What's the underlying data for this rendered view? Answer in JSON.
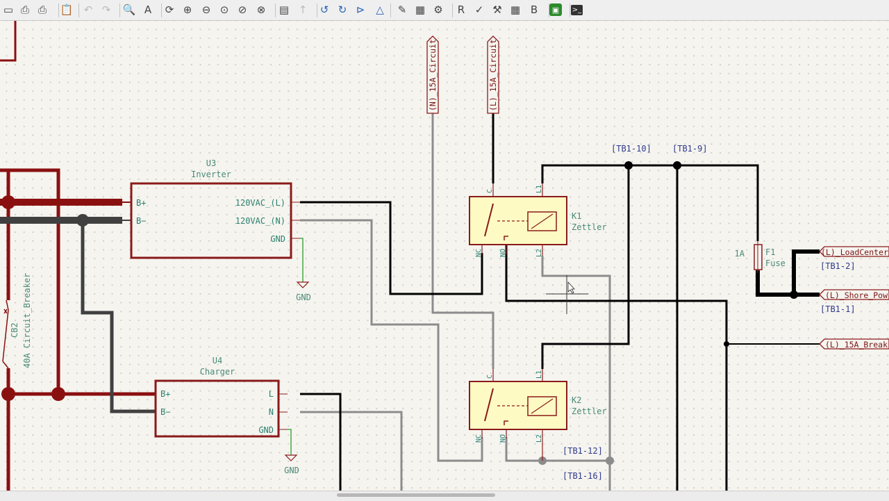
{
  "toolbar": {
    "buttons": [
      {
        "name": "save-icon",
        "glyph": "▭"
      },
      {
        "name": "print-icon",
        "glyph": "⎙"
      },
      {
        "name": "plot-icon",
        "glyph": "⎙"
      },
      {
        "name": "paste-icon",
        "glyph": "📋"
      },
      {
        "name": "undo-icon",
        "glyph": "↶"
      },
      {
        "name": "redo-icon",
        "glyph": "↷"
      },
      {
        "name": "find-icon",
        "glyph": "🔍"
      },
      {
        "name": "find-replace-icon",
        "glyph": "A"
      },
      {
        "name": "refresh-icon",
        "glyph": "⟳"
      },
      {
        "name": "zoom-in-icon",
        "glyph": "⊕"
      },
      {
        "name": "zoom-out-icon",
        "glyph": "⊖"
      },
      {
        "name": "zoom-fit-icon",
        "glyph": "⊙"
      },
      {
        "name": "zoom-objects-icon",
        "glyph": "⊘"
      },
      {
        "name": "zoom-selection-icon",
        "glyph": "⊗"
      },
      {
        "name": "hierarchy-navigator-icon",
        "glyph": "▤"
      },
      {
        "name": "leave-sheet-icon",
        "glyph": "↑"
      },
      {
        "name": "rotate-ccw-icon",
        "glyph": "↺"
      },
      {
        "name": "rotate-cw-icon",
        "glyph": "↻"
      },
      {
        "name": "mirror-vertical-icon",
        "glyph": "⊳"
      },
      {
        "name": "mirror-horizontal-icon",
        "glyph": "△"
      },
      {
        "name": "symbol-editor-icon",
        "glyph": "✎"
      },
      {
        "name": "symbol-browser-icon",
        "glyph": "▦"
      },
      {
        "name": "footprint-editor-icon",
        "glyph": "⚙"
      },
      {
        "name": "annotate-icon",
        "glyph": "R"
      },
      {
        "name": "erc-icon",
        "glyph": "✓"
      },
      {
        "name": "assign-footprints-icon",
        "glyph": "⚒"
      },
      {
        "name": "symbol-fields-table-icon",
        "glyph": "▦"
      },
      {
        "name": "bom-icon",
        "glyph": "B"
      },
      {
        "name": "pcb-editor-icon",
        "glyph": "▣"
      },
      {
        "name": "scripting-console-icon",
        "glyph": ">_"
      }
    ]
  },
  "schematic": {
    "components": {
      "u3": {
        "ref": "U3",
        "value": "Inverter",
        "pins": {
          "bplus": "B+",
          "bminus": "B−",
          "out_l": "120VAC_(L)",
          "out_n": "120VAC_(N)",
          "gnd": "GND"
        }
      },
      "u4": {
        "ref": "U4",
        "value": "Charger",
        "pins": {
          "bplus": "B+",
          "bminus": "B−",
          "l": "L",
          "n": "N",
          "gnd": "GND"
        }
      },
      "k1": {
        "ref": "K1",
        "value": "Zettler",
        "pins": {
          "c": "C",
          "l1": "L1",
          "nc": "NC",
          "no": "NO",
          "l2": "L2"
        }
      },
      "k2": {
        "ref": "K2",
        "value": "Zettler",
        "pins": {
          "c": "C",
          "l1": "L1",
          "nc": "NC",
          "no": "NO",
          "l2": "L2"
        }
      },
      "f1": {
        "ref": "F1",
        "value": "Fuse",
        "rating": "1A"
      },
      "cb2": {
        "ref": "CB2",
        "value": "40A Circuit_Breaker"
      }
    },
    "power": {
      "gnd1": "GND",
      "gnd2": "GND"
    },
    "net_labels": {
      "tb1_10": "[TB1-10]",
      "tb1_9": "[TB1-9]",
      "tb1_2": "[TB1-2]",
      "tb1_1": "[TB1-1]",
      "tb1_12": "[TB1-12]",
      "tb1_16": "[TB1-16]"
    },
    "global_labels": {
      "n_15a_circuit": "(N)_15A_Circuit",
      "l_15a_circuit": "(L)_15A_Circuit",
      "load_center": "(L)_LoadCenter",
      "shore_power": "(L)_Shore_Pow",
      "breaker": "(L)_15A_Break"
    },
    "colors": {
      "power_wire": "#8a1010",
      "neg_wire": "#404040",
      "line_wire": "#000000",
      "neutral_wire": "#8c8c8c",
      "component_outline": "#8a1a1a",
      "relay_fill": "#fdfbc3",
      "label_text": "#4a8a78",
      "net_text": "#2e3a8c"
    }
  }
}
